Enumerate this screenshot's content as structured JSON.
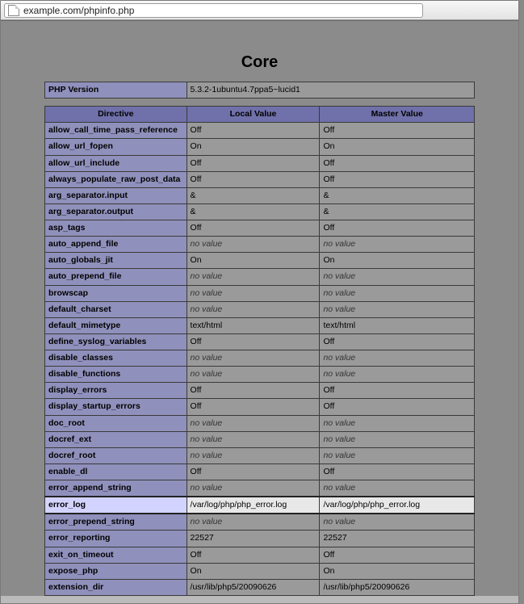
{
  "url": "example.com/phpinfo.php",
  "section_title": "Core",
  "version_row": {
    "label": "PHP Version",
    "value": "5.3.2-1ubuntu4.7ppa5~lucid1"
  },
  "headers": {
    "directive": "Directive",
    "local": "Local Value",
    "master": "Master Value"
  },
  "no_value_label": "no value",
  "highlight_directive": "error_log",
  "rows": [
    {
      "d": "allow_call_time_pass_reference",
      "l": "Off",
      "m": "Off"
    },
    {
      "d": "allow_url_fopen",
      "l": "On",
      "m": "On"
    },
    {
      "d": "allow_url_include",
      "l": "Off",
      "m": "Off"
    },
    {
      "d": "always_populate_raw_post_data",
      "l": "Off",
      "m": "Off"
    },
    {
      "d": "arg_separator.input",
      "l": "&",
      "m": "&"
    },
    {
      "d": "arg_separator.output",
      "l": "&",
      "m": "&"
    },
    {
      "d": "asp_tags",
      "l": "Off",
      "m": "Off"
    },
    {
      "d": "auto_append_file",
      "l": null,
      "m": null
    },
    {
      "d": "auto_globals_jit",
      "l": "On",
      "m": "On"
    },
    {
      "d": "auto_prepend_file",
      "l": null,
      "m": null
    },
    {
      "d": "browscap",
      "l": null,
      "m": null
    },
    {
      "d": "default_charset",
      "l": null,
      "m": null
    },
    {
      "d": "default_mimetype",
      "l": "text/html",
      "m": "text/html"
    },
    {
      "d": "define_syslog_variables",
      "l": "Off",
      "m": "Off"
    },
    {
      "d": "disable_classes",
      "l": null,
      "m": null
    },
    {
      "d": "disable_functions",
      "l": null,
      "m": null
    },
    {
      "d": "display_errors",
      "l": "Off",
      "m": "Off"
    },
    {
      "d": "display_startup_errors",
      "l": "Off",
      "m": "Off"
    },
    {
      "d": "doc_root",
      "l": null,
      "m": null
    },
    {
      "d": "docref_ext",
      "l": null,
      "m": null
    },
    {
      "d": "docref_root",
      "l": null,
      "m": null
    },
    {
      "d": "enable_dl",
      "l": "Off",
      "m": "Off"
    },
    {
      "d": "error_append_string",
      "l": null,
      "m": null
    },
    {
      "d": "error_log",
      "l": "/var/log/php/php_error.log",
      "m": "/var/log/php/php_error.log"
    },
    {
      "d": "error_prepend_string",
      "l": null,
      "m": null
    },
    {
      "d": "error_reporting",
      "l": "22527",
      "m": "22527"
    },
    {
      "d": "exit_on_timeout",
      "l": "Off",
      "m": "Off"
    },
    {
      "d": "expose_php",
      "l": "On",
      "m": "On"
    },
    {
      "d": "extension_dir",
      "l": "/usr/lib/php5/20090626",
      "m": "/usr/lib/php5/20090626"
    }
  ]
}
